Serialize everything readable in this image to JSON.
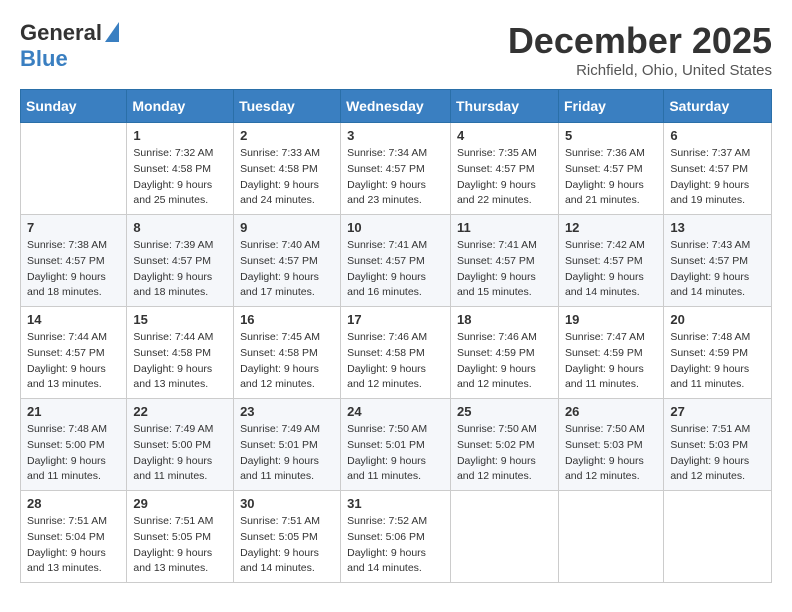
{
  "header": {
    "logo_general": "General",
    "logo_blue": "Blue",
    "month_title": "December 2025",
    "location": "Richfield, Ohio, United States"
  },
  "weekdays": [
    "Sunday",
    "Monday",
    "Tuesday",
    "Wednesday",
    "Thursday",
    "Friday",
    "Saturday"
  ],
  "weeks": [
    [
      {
        "day": "",
        "sunrise": "",
        "sunset": "",
        "daylight": ""
      },
      {
        "day": "1",
        "sunrise": "Sunrise: 7:32 AM",
        "sunset": "Sunset: 4:58 PM",
        "daylight": "Daylight: 9 hours and 25 minutes."
      },
      {
        "day": "2",
        "sunrise": "Sunrise: 7:33 AM",
        "sunset": "Sunset: 4:58 PM",
        "daylight": "Daylight: 9 hours and 24 minutes."
      },
      {
        "day": "3",
        "sunrise": "Sunrise: 7:34 AM",
        "sunset": "Sunset: 4:57 PM",
        "daylight": "Daylight: 9 hours and 23 minutes."
      },
      {
        "day": "4",
        "sunrise": "Sunrise: 7:35 AM",
        "sunset": "Sunset: 4:57 PM",
        "daylight": "Daylight: 9 hours and 22 minutes."
      },
      {
        "day": "5",
        "sunrise": "Sunrise: 7:36 AM",
        "sunset": "Sunset: 4:57 PM",
        "daylight": "Daylight: 9 hours and 21 minutes."
      },
      {
        "day": "6",
        "sunrise": "Sunrise: 7:37 AM",
        "sunset": "Sunset: 4:57 PM",
        "daylight": "Daylight: 9 hours and 19 minutes."
      }
    ],
    [
      {
        "day": "7",
        "sunrise": "Sunrise: 7:38 AM",
        "sunset": "Sunset: 4:57 PM",
        "daylight": "Daylight: 9 hours and 18 minutes."
      },
      {
        "day": "8",
        "sunrise": "Sunrise: 7:39 AM",
        "sunset": "Sunset: 4:57 PM",
        "daylight": "Daylight: 9 hours and 18 minutes."
      },
      {
        "day": "9",
        "sunrise": "Sunrise: 7:40 AM",
        "sunset": "Sunset: 4:57 PM",
        "daylight": "Daylight: 9 hours and 17 minutes."
      },
      {
        "day": "10",
        "sunrise": "Sunrise: 7:41 AM",
        "sunset": "Sunset: 4:57 PM",
        "daylight": "Daylight: 9 hours and 16 minutes."
      },
      {
        "day": "11",
        "sunrise": "Sunrise: 7:41 AM",
        "sunset": "Sunset: 4:57 PM",
        "daylight": "Daylight: 9 hours and 15 minutes."
      },
      {
        "day": "12",
        "sunrise": "Sunrise: 7:42 AM",
        "sunset": "Sunset: 4:57 PM",
        "daylight": "Daylight: 9 hours and 14 minutes."
      },
      {
        "day": "13",
        "sunrise": "Sunrise: 7:43 AM",
        "sunset": "Sunset: 4:57 PM",
        "daylight": "Daylight: 9 hours and 14 minutes."
      }
    ],
    [
      {
        "day": "14",
        "sunrise": "Sunrise: 7:44 AM",
        "sunset": "Sunset: 4:57 PM",
        "daylight": "Daylight: 9 hours and 13 minutes."
      },
      {
        "day": "15",
        "sunrise": "Sunrise: 7:44 AM",
        "sunset": "Sunset: 4:58 PM",
        "daylight": "Daylight: 9 hours and 13 minutes."
      },
      {
        "day": "16",
        "sunrise": "Sunrise: 7:45 AM",
        "sunset": "Sunset: 4:58 PM",
        "daylight": "Daylight: 9 hours and 12 minutes."
      },
      {
        "day": "17",
        "sunrise": "Sunrise: 7:46 AM",
        "sunset": "Sunset: 4:58 PM",
        "daylight": "Daylight: 9 hours and 12 minutes."
      },
      {
        "day": "18",
        "sunrise": "Sunrise: 7:46 AM",
        "sunset": "Sunset: 4:59 PM",
        "daylight": "Daylight: 9 hours and 12 minutes."
      },
      {
        "day": "19",
        "sunrise": "Sunrise: 7:47 AM",
        "sunset": "Sunset: 4:59 PM",
        "daylight": "Daylight: 9 hours and 11 minutes."
      },
      {
        "day": "20",
        "sunrise": "Sunrise: 7:48 AM",
        "sunset": "Sunset: 4:59 PM",
        "daylight": "Daylight: 9 hours and 11 minutes."
      }
    ],
    [
      {
        "day": "21",
        "sunrise": "Sunrise: 7:48 AM",
        "sunset": "Sunset: 5:00 PM",
        "daylight": "Daylight: 9 hours and 11 minutes."
      },
      {
        "day": "22",
        "sunrise": "Sunrise: 7:49 AM",
        "sunset": "Sunset: 5:00 PM",
        "daylight": "Daylight: 9 hours and 11 minutes."
      },
      {
        "day": "23",
        "sunrise": "Sunrise: 7:49 AM",
        "sunset": "Sunset: 5:01 PM",
        "daylight": "Daylight: 9 hours and 11 minutes."
      },
      {
        "day": "24",
        "sunrise": "Sunrise: 7:50 AM",
        "sunset": "Sunset: 5:01 PM",
        "daylight": "Daylight: 9 hours and 11 minutes."
      },
      {
        "day": "25",
        "sunrise": "Sunrise: 7:50 AM",
        "sunset": "Sunset: 5:02 PM",
        "daylight": "Daylight: 9 hours and 12 minutes."
      },
      {
        "day": "26",
        "sunrise": "Sunrise: 7:50 AM",
        "sunset": "Sunset: 5:03 PM",
        "daylight": "Daylight: 9 hours and 12 minutes."
      },
      {
        "day": "27",
        "sunrise": "Sunrise: 7:51 AM",
        "sunset": "Sunset: 5:03 PM",
        "daylight": "Daylight: 9 hours and 12 minutes."
      }
    ],
    [
      {
        "day": "28",
        "sunrise": "Sunrise: 7:51 AM",
        "sunset": "Sunset: 5:04 PM",
        "daylight": "Daylight: 9 hours and 13 minutes."
      },
      {
        "day": "29",
        "sunrise": "Sunrise: 7:51 AM",
        "sunset": "Sunset: 5:05 PM",
        "daylight": "Daylight: 9 hours and 13 minutes."
      },
      {
        "day": "30",
        "sunrise": "Sunrise: 7:51 AM",
        "sunset": "Sunset: 5:05 PM",
        "daylight": "Daylight: 9 hours and 14 minutes."
      },
      {
        "day": "31",
        "sunrise": "Sunrise: 7:52 AM",
        "sunset": "Sunset: 5:06 PM",
        "daylight": "Daylight: 9 hours and 14 minutes."
      },
      {
        "day": "",
        "sunrise": "",
        "sunset": "",
        "daylight": ""
      },
      {
        "day": "",
        "sunrise": "",
        "sunset": "",
        "daylight": ""
      },
      {
        "day": "",
        "sunrise": "",
        "sunset": "",
        "daylight": ""
      }
    ]
  ]
}
